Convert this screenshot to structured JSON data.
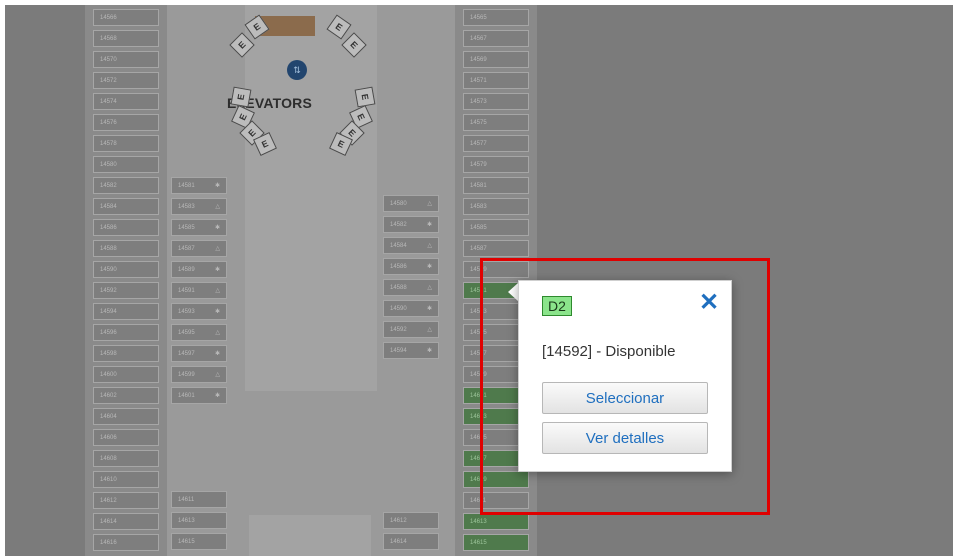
{
  "map": {
    "elevators_label": "ELEVATORS",
    "elevator_letter": "E",
    "left_outer_stalls": [
      "14566",
      "14568",
      "14570",
      "14572",
      "14574",
      "14576",
      "14578",
      "14580",
      "14582",
      "14584",
      "14586",
      "14588",
      "14590",
      "14592",
      "14594",
      "14596",
      "14598",
      "14600",
      "14602",
      "14604",
      "14606",
      "14608",
      "14610",
      "14612",
      "14614",
      "14616"
    ],
    "right_outer_stalls": [
      "14565",
      "14567",
      "14569",
      "14571",
      "14573",
      "14575",
      "14577",
      "14579",
      "14581",
      "14583",
      "14585",
      "14587",
      "14589",
      "14591",
      "14593",
      "14595",
      "14597",
      "14599",
      "14601",
      "14603",
      "14605",
      "14607",
      "14609",
      "14611",
      "14613",
      "14615"
    ],
    "inner_left_stalls": [
      "14581",
      "14583",
      "14585",
      "14587",
      "14589",
      "14591",
      "14593",
      "14595",
      "14597",
      "14599",
      "14601"
    ],
    "inner_right_stalls": [
      "14580",
      "14582",
      "14584",
      "14586",
      "14588",
      "14590",
      "14592",
      "14594"
    ],
    "lower_stalls_left": [
      "14611",
      "14613",
      "14615"
    ],
    "lower_stalls_right": [
      "14612",
      "14614"
    ]
  },
  "popup": {
    "badge": "D2",
    "close_icon": "close-icon",
    "status": "[14592] - Disponible",
    "select_label": "Seleccionar",
    "details_label": "Ver detalles"
  },
  "colors": {
    "highlight": "#e00000",
    "available": "#8be48b",
    "link": "#1f6fbf"
  }
}
